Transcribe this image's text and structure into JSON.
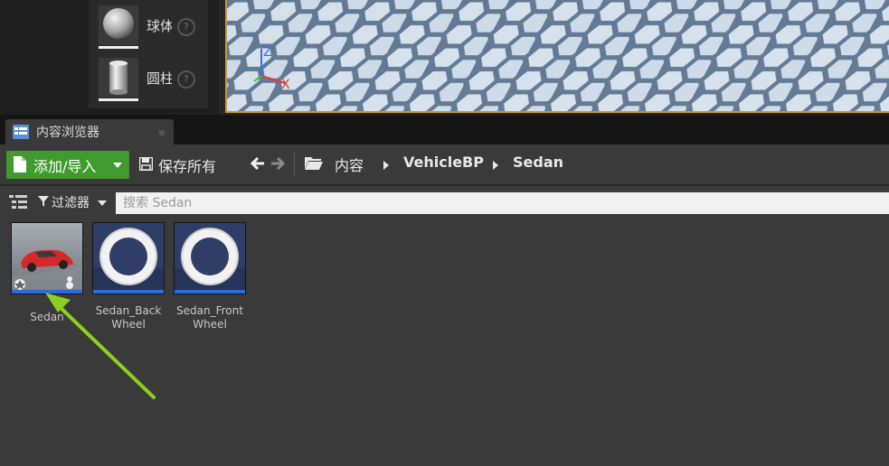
{
  "place_panel": {
    "items": [
      {
        "label": "球体",
        "icon": "sphere-icon"
      },
      {
        "label": "圆柱",
        "icon": "cylinder-icon"
      }
    ],
    "help_glyph": "?"
  },
  "viewport": {
    "axis_z": "Z",
    "axis_x": "X"
  },
  "tab": {
    "label": "内容浏览器"
  },
  "toolbar": {
    "add_import_label": "添加/导入",
    "save_all_label": "保存所有"
  },
  "breadcrumb": [
    "内容",
    "VehicleBP",
    "Sedan"
  ],
  "filter": {
    "filters_label": "过滤器",
    "search_placeholder": "搜索 Sedan"
  },
  "assets": [
    {
      "name": "Sedan",
      "type": "blueprint",
      "icon": "car-thumbnail"
    },
    {
      "name": "Sedan_Back Wheel",
      "line1": "Sedan_Back",
      "line2": "Wheel",
      "type": "wheel",
      "icon": "wheel-thumbnail"
    },
    {
      "name": "Sedan_Front Wheel",
      "line1": "Sedan_Front",
      "line2": "Wheel",
      "type": "wheel",
      "icon": "wheel-thumbnail"
    }
  ],
  "colors": {
    "add_button": "#3f9b2e",
    "asset_bar": "#2f6bd8",
    "annotation_arrow": "#8ccf1e",
    "viewport_border": "#c29a3b"
  }
}
